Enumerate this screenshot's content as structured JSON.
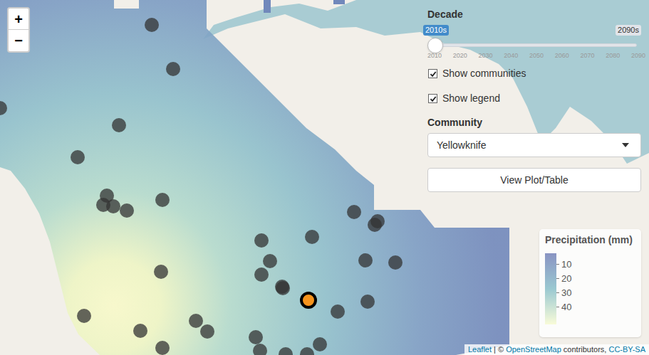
{
  "zoom": {
    "in": "+",
    "out": "−"
  },
  "decade": {
    "label": "Decade",
    "value": "2010s",
    "max": "2090s",
    "level": 0,
    "ticks": [
      "2010",
      "2020",
      "2030",
      "2040",
      "2050",
      "2060",
      "2070",
      "2080",
      "2090"
    ]
  },
  "checkboxes": [
    {
      "label": "Show communities",
      "checked": true
    },
    {
      "label": "Show legend",
      "checked": true
    }
  ],
  "community": {
    "label": "Community",
    "value": "Yellowknife"
  },
  "button": "View Plot/Table",
  "legend": {
    "title": "Precipitation (mm)",
    "ticks": [
      "10",
      "20",
      "30",
      "40"
    ]
  },
  "attribution": [
    {
      "text": "Leaflet",
      "kind": "link"
    },
    {
      "text": " | © ",
      "kind": "text"
    },
    {
      "text": "OpenStreetMap",
      "kind": "link"
    },
    {
      "text": " contributors, ",
      "kind": "text"
    },
    {
      "text": "CC-BY-SA",
      "kind": "link"
    }
  ],
  "communities": [
    {
      "selected": false
    },
    {
      "selected": false
    },
    {
      "selected": false
    },
    {
      "selected": false
    },
    {
      "selected": false
    },
    {
      "selected": false
    },
    {
      "selected": false
    },
    {
      "selected": false
    },
    {
      "selected": false
    },
    {
      "selected": false
    },
    {
      "selected": false
    },
    {
      "selected": false
    },
    {
      "selected": false
    },
    {
      "selected": false
    },
    {
      "selected": false
    },
    {
      "selected": false
    },
    {
      "selected": false
    },
    {
      "selected": false
    },
    {
      "selected": false
    },
    {
      "selected": false
    },
    {
      "selected": false
    },
    {
      "selected": false
    },
    {
      "selected": true
    },
    {
      "selected": false
    },
    {
      "selected": false
    },
    {
      "selected": false
    },
    {
      "selected": false
    },
    {
      "selected": false
    },
    {
      "selected": false
    },
    {
      "selected": false
    },
    {
      "selected": false
    },
    {
      "selected": false
    },
    {
      "selected": false
    },
    {
      "selected": false
    },
    {
      "selected": false
    }
  ]
}
